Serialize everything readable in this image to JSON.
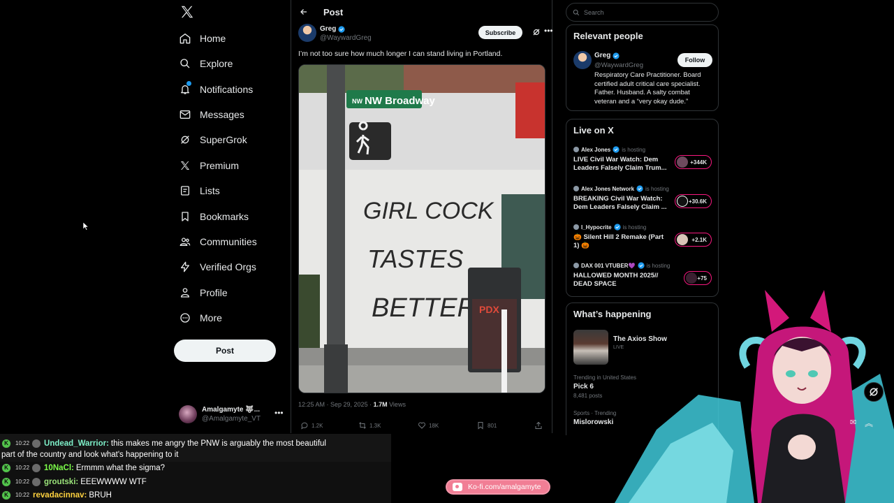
{
  "nav": {
    "items": [
      {
        "label": "Home",
        "icon": "home-icon"
      },
      {
        "label": "Explore",
        "icon": "search-icon"
      },
      {
        "label": "Notifications",
        "icon": "bell-icon"
      },
      {
        "label": "Messages",
        "icon": "envelope-icon"
      },
      {
        "label": "SuperGrok",
        "icon": "grok-icon"
      },
      {
        "label": "Premium",
        "icon": "x-logo-icon"
      },
      {
        "label": "Lists",
        "icon": "list-icon"
      },
      {
        "label": "Bookmarks",
        "icon": "bookmark-icon"
      },
      {
        "label": "Communities",
        "icon": "people-icon"
      },
      {
        "label": "Verified Orgs",
        "icon": "lightning-icon"
      },
      {
        "label": "Profile",
        "icon": "person-icon"
      },
      {
        "label": "More",
        "icon": "more-circle-icon"
      }
    ],
    "post_button": "Post",
    "account": {
      "name": "Amalgamyte 🐺...",
      "handle": "@Amalgamyte_VT"
    }
  },
  "post": {
    "header_title": "Post",
    "author_name": "Greg",
    "author_handle": "@WaywardGreg",
    "subscribe_label": "Subscribe",
    "text": "I’m not too sure how much longer I can stand living in Portland.",
    "image_sign": "NW Broadway",
    "graffiti": [
      "GIRL COCK",
      "TASTES",
      "BETTER"
    ],
    "bin_graffiti": "PDX",
    "time": "12:25 AM · Sep 29, 2025 · ",
    "views_count": "1.7M",
    "views_label": " Views",
    "replies": "1.2K",
    "reposts": "1.3K",
    "likes": "18K",
    "bookmarks": "801"
  },
  "right": {
    "search_placeholder": "Search",
    "relevant_title": "Relevant people",
    "relevant": {
      "name": "Greg",
      "handle": "@WaywardGreg",
      "follow_label": "Follow",
      "bio": "Respiratory Care Practitioner. Board certified adult critical care specialist. Father. Husband. A salty combat veteran and a “very okay dude.”"
    },
    "live_title": "Live on X",
    "live": [
      {
        "host": "Alex Jones",
        "is": "is hosting",
        "title": "LIVE Civil War Watch: Dem Leaders Falsely Claim Trum...",
        "count": "+344K"
      },
      {
        "host": "Alex Jones Network",
        "is": "is hosting",
        "title": "BREAKING Civil War Watch: Dem Leaders Falsely Claim ...",
        "count": "+30.6K"
      },
      {
        "host": "I_Hypocrite",
        "is": "is hosting",
        "title": "🎃 Silent Hill 2 Remake (Part 1) 🎃",
        "count": "+2.1K"
      },
      {
        "host": "DAX 001 VTUBER💜",
        "is": "is hosting",
        "title": "HALLOWED MONTH 2025// DEAD SPACE",
        "count": "+75"
      }
    ],
    "happening_title": "What’s happening",
    "axios": {
      "title": "The Axios Show",
      "status": "LIVE"
    },
    "trends": [
      {
        "context": "Trending in United States",
        "name": "Pick 6",
        "count": "8,481 posts"
      },
      {
        "context": "Sports · Trending",
        "name": "Mislorowski",
        "count": ""
      }
    ]
  },
  "chat": [
    {
      "time": "10:22",
      "user": "Undead_Warrior:",
      "user_color": "#7ef0c9",
      "msg": "this makes me angry the PNW is arguably the most beautiful",
      "msg2": "part of the country and look what's happening to it"
    },
    {
      "time": "10:22",
      "user": "10NaCl:",
      "user_color": "#7dff4a",
      "msg": "Ermmm what the sigma?"
    },
    {
      "time": "10:22",
      "user": "groutski:",
      "user_color": "#9be37a",
      "msg": "EEEWWWW WTF"
    },
    {
      "time": "10:22",
      "user": "revadacinnav:",
      "user_color": "#ffd23f",
      "msg": "BRUH"
    }
  ],
  "kofi": "Ko-fi.com/amalgamyte",
  "colors": {
    "accent": "#1d9bf0",
    "live": "#f91880",
    "kofi": "#f17e95"
  }
}
